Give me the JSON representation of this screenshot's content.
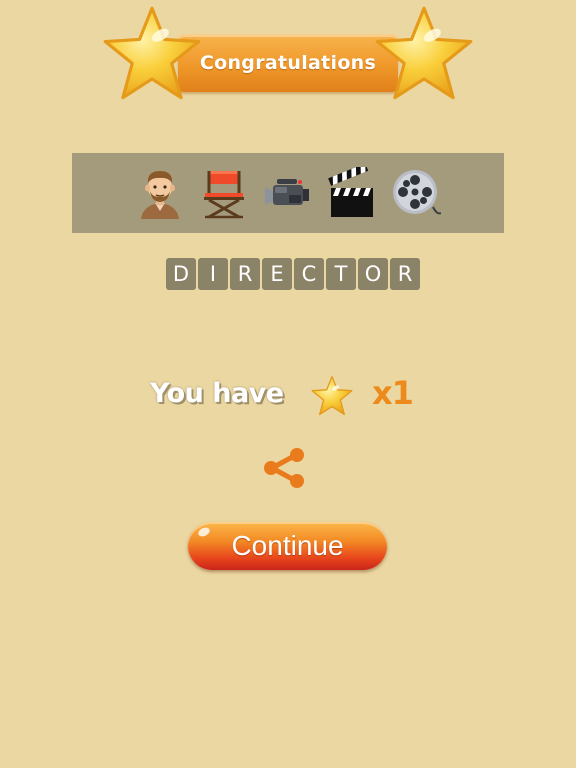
{
  "banner": {
    "title": "Congratulations",
    "icon": "star-icon"
  },
  "clues": [
    {
      "icon": "man-face-icon"
    },
    {
      "icon": "directors-chair-icon"
    },
    {
      "icon": "video-camera-icon"
    },
    {
      "icon": "clapperboard-icon"
    },
    {
      "icon": "film-reel-icon"
    }
  ],
  "answer": {
    "letters": [
      "D",
      "I",
      "R",
      "E",
      "C",
      "T",
      "O",
      "R"
    ]
  },
  "reward": {
    "label": "You have",
    "icon": "star-icon",
    "multiplier": "x1"
  },
  "share": {
    "icon": "share-icon"
  },
  "continue_button": {
    "label": "Continue"
  },
  "colors": {
    "background": "#ebd7a2",
    "ribbon": "#f0982a",
    "clue_strip": "#a49a7c",
    "letter_tile": "#8b8367",
    "multiplier": "#ec8a1b",
    "continue_button": "#e8461c"
  }
}
